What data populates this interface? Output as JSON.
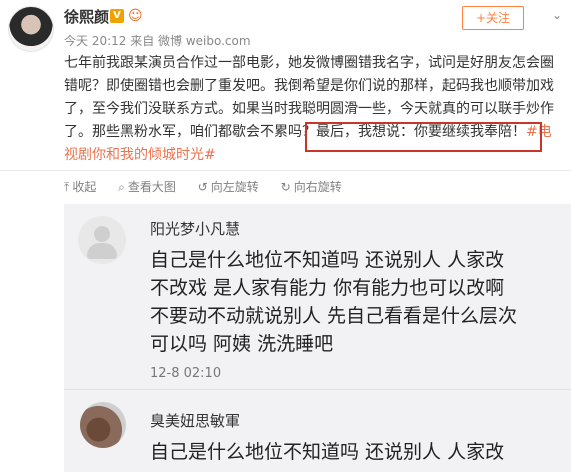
{
  "post": {
    "author": "徐熙颜",
    "vip_badge": "V",
    "meta": "今天 20:12 来自 微博 weibo.com",
    "follow_label": "+关注",
    "text_before": "七年前我跟某演员合作过一部电影，她发微博圈错我名字，试问是好朋友怎会圈错呢？即使圈错也会删了重发吧。我倒希望是你们说的那样，起码我也顺带加戏了，至今我们没联系方式。如果当时我聪明圆滑一些，今天就真的可以联手炒作了。那些黑粉水军，咱们都歇会不累吗？",
    "text_highlight": "最后，我想说：你要继续我奉陪！",
    "hashtag": "#电视剧你和我的倾城时光#"
  },
  "toolbar": {
    "collapse": "收起",
    "view_large": "查看大图",
    "rotate_left": "向左旋转",
    "rotate_right": "向右旋转"
  },
  "comments": [
    {
      "name": "阳光梦小凡慧",
      "lines": [
        "自己是什么地位不知道吗  还说别人  人家改",
        "不改戏 是人家有能力  你有能力也可以改啊",
        "不要动不动就说别人  先自己看看是什么层次",
        "可以吗  阿姨  洗洗睡吧"
      ],
      "time": "12-8 02:10"
    },
    {
      "name": "臭美妞思敏軍",
      "lines": [
        "自己是什么地位不知道吗  还说别人  人家改"
      ]
    }
  ],
  "colors": {
    "accent": "#eb7350",
    "follow": "#ff8140",
    "highlight_border": "#c9342b"
  }
}
